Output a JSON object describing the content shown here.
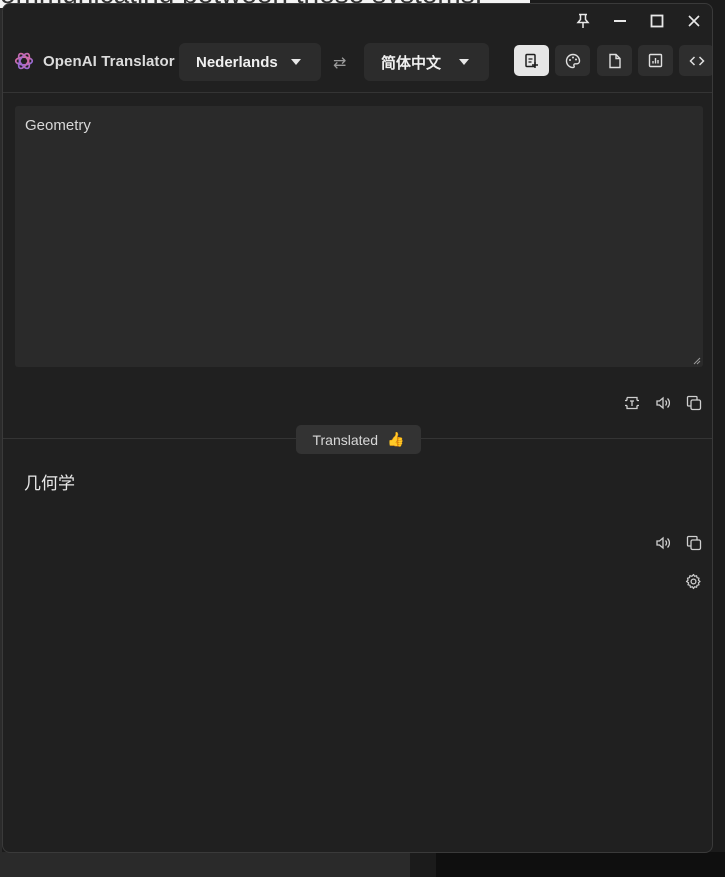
{
  "background": {
    "partial_text": "ommunicating between these systems."
  },
  "window": {
    "controls": [
      {
        "name": "pin-icon",
        "label": "Pin"
      },
      {
        "name": "minimize-icon",
        "label": "Minimize"
      },
      {
        "name": "maximize-icon",
        "label": "Maximize"
      },
      {
        "name": "close-icon",
        "label": "Close"
      }
    ]
  },
  "header": {
    "app_title": "OpenAI Translator",
    "source_language": "Nederlands",
    "swap_symbol": "⇄",
    "target_language": "简体中文",
    "actions": [
      {
        "name": "translate-mode-icon",
        "active": true
      },
      {
        "name": "theme-icon",
        "active": false
      },
      {
        "name": "document-icon",
        "active": false
      },
      {
        "name": "statistics-icon",
        "active": false
      },
      {
        "name": "code-icon",
        "active": false
      }
    ]
  },
  "source": {
    "text": "Geometry"
  },
  "status": {
    "label": "Translated",
    "emoji": "👍"
  },
  "result": {
    "text": "几何学"
  },
  "colors": {
    "window_bg": "#202020",
    "input_bg": "#2a2a2a",
    "accent_active": "#e6e6e6",
    "select_bg": "#2c2c2c"
  }
}
